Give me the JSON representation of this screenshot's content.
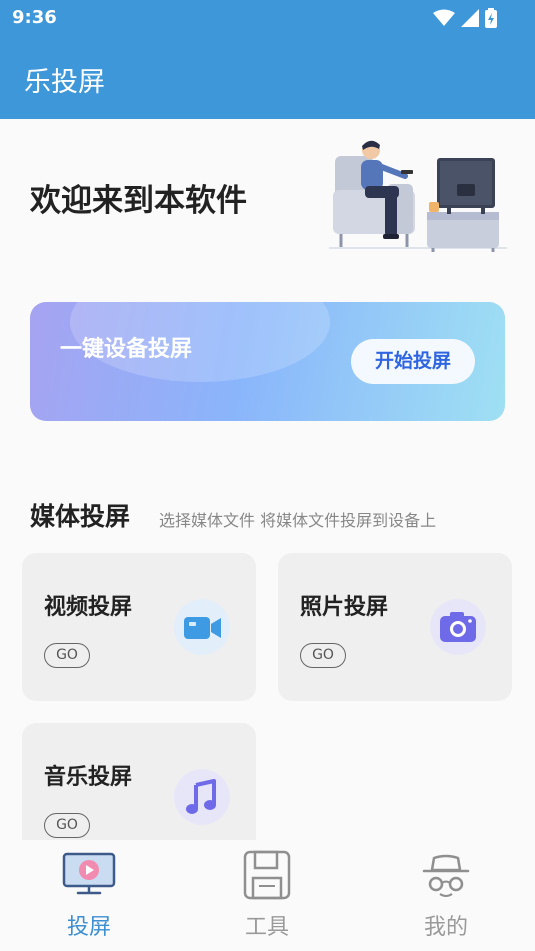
{
  "status_bar": {
    "time": "9:36",
    "icons": [
      "wifi-icon",
      "signal-icon",
      "battery-charging-icon"
    ]
  },
  "app_bar": {
    "title": "乐投屏"
  },
  "welcome": {
    "text": "欢迎来到本软件"
  },
  "banner": {
    "label": "一键设备投屏",
    "button": "开始投屏"
  },
  "media_section": {
    "title": "媒体投屏",
    "subtitle": "选择媒体文件 将媒体文件投屏到设备上"
  },
  "cards": [
    {
      "title": "视频投屏",
      "go": "GO",
      "icon": "video-camera-icon"
    },
    {
      "title": "照片投屏",
      "go": "GO",
      "icon": "photo-camera-icon"
    },
    {
      "title": "音乐投屏",
      "go": "GO",
      "icon": "music-note-icon"
    }
  ],
  "tabs": [
    {
      "label": "投屏",
      "icon": "monitor-play-icon",
      "active": true
    },
    {
      "label": "工具",
      "icon": "floppy-disk-icon",
      "active": false
    },
    {
      "label": "我的",
      "icon": "spy-hat-glasses-icon",
      "active": false
    }
  ],
  "colors": {
    "primary": "#3d97d9",
    "tab_active": "#3d8fd1",
    "tab_inactive": "#9a9a9a",
    "button_text": "#2f66e0"
  }
}
